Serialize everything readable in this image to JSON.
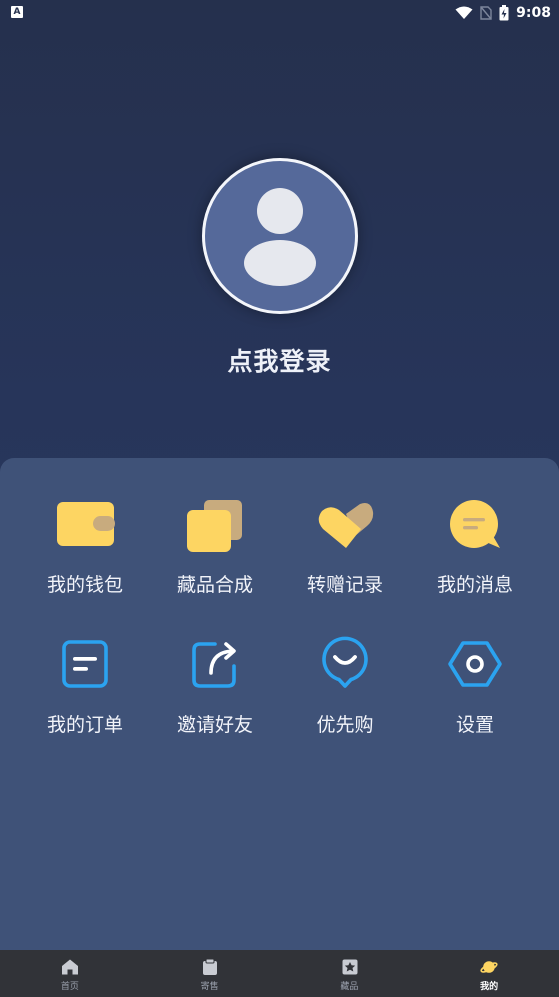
{
  "status_bar": {
    "left_badge": "A",
    "time": "9:08",
    "icons": [
      "notification-a-icon",
      "wifi-icon",
      "no-sim-icon",
      "battery-icon"
    ]
  },
  "profile": {
    "avatar_icon": "user-placeholder-icon",
    "login_text": "点我登录"
  },
  "menu": {
    "items": [
      {
        "label": "我的钱包",
        "icon": "wallet-icon"
      },
      {
        "label": "藏品合成",
        "icon": "collection-merge-icon"
      },
      {
        "label": "转赠记录",
        "icon": "heart-transfer-icon"
      },
      {
        "label": "我的消息",
        "icon": "message-icon"
      },
      {
        "label": "我的订单",
        "icon": "order-icon"
      },
      {
        "label": "邀请好友",
        "icon": "share-icon"
      },
      {
        "label": "优先购",
        "icon": "priority-buy-icon"
      },
      {
        "label": "设置",
        "icon": "settings-icon"
      }
    ]
  },
  "bottom_nav": {
    "items": [
      {
        "label": "首页",
        "icon": "home-icon",
        "active": false
      },
      {
        "label": "寄售",
        "icon": "consign-icon",
        "active": false
      },
      {
        "label": "藏品",
        "icon": "collection-icon",
        "active": false
      },
      {
        "label": "我的",
        "icon": "planet-icon",
        "active": true
      }
    ]
  },
  "colors": {
    "background": "#25304d",
    "panel": "#3f5278",
    "accent_yellow": "#fdd562",
    "accent_tan": "#c8ab7e",
    "accent_blue": "#2ba3f0",
    "nav_bg": "#313338"
  }
}
